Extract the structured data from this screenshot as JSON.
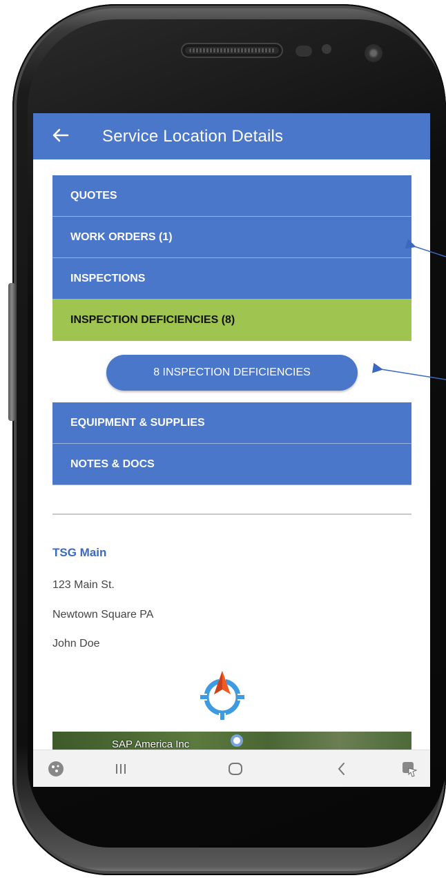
{
  "appbar": {
    "title": "Service Location Details",
    "color": "#4a77c9"
  },
  "menu": {
    "items": [
      {
        "label": "QUOTES"
      },
      {
        "label": "WORK ORDERS (1)"
      },
      {
        "label": "INSPECTIONS"
      },
      {
        "label": "INSPECTION DEFICIENCIES (8)",
        "active": true
      }
    ],
    "active_color": "#9fc44f"
  },
  "pill_button": {
    "label": "8 INSPECTION DEFICIENCIES"
  },
  "menu2": {
    "items": [
      {
        "label": "EQUIPMENT & SUPPLIES"
      },
      {
        "label": "NOTES & DOCS"
      }
    ]
  },
  "location": {
    "name": "TSG Main",
    "address_line1": "123 Main St.",
    "address_line2": "Newtown Square  PA",
    "contact": "John Doe"
  },
  "map": {
    "label": "SAP America Inc"
  },
  "icons": {
    "back": "arrow-left-icon",
    "navigate": "navigation-compass-icon",
    "map_pin": "map-pin-icon",
    "nav_assistant": "assistant-icon",
    "nav_recents": "recents-icon",
    "nav_home": "home-icon",
    "nav_back": "back-icon",
    "nav_screenshot": "screenshot-icon"
  }
}
